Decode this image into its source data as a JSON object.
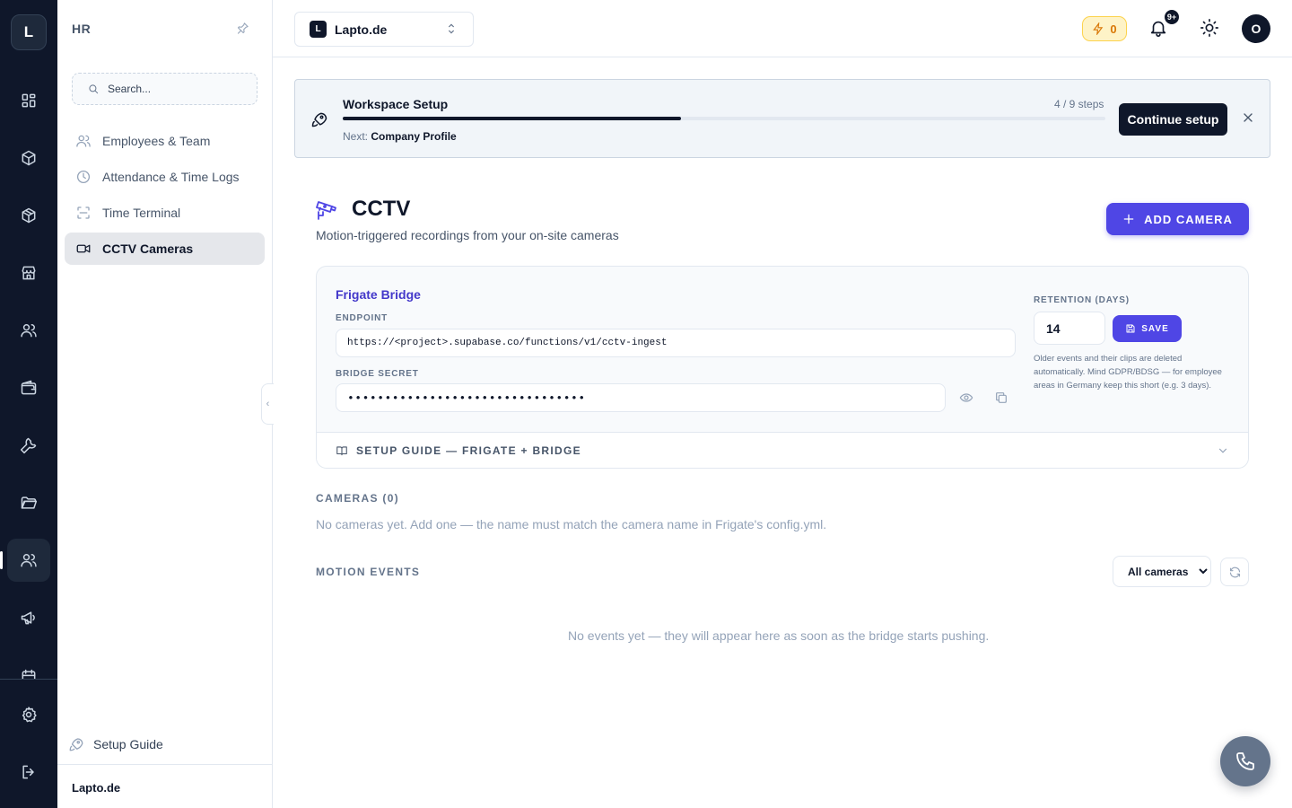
{
  "rail": {
    "logo": "L",
    "icons": [
      "dashboard-icon",
      "box-icon",
      "package-icon",
      "store-icon",
      "users-icon",
      "wallet-icon",
      "wrench-icon",
      "folder-icon",
      "hr-users-icon",
      "megaphone-icon",
      "settings-icon",
      "logout-icon"
    ]
  },
  "sidebar": {
    "title": "HR",
    "search_placeholder": "Search...",
    "items": [
      {
        "label": "Employees & Team",
        "icon": "users-icon"
      },
      {
        "label": "Attendance & Time Logs",
        "icon": "clock-icon"
      },
      {
        "label": "Time Terminal",
        "icon": "scan-icon"
      },
      {
        "label": "CCTV Cameras",
        "icon": "video-icon"
      }
    ],
    "setup_guide": "Setup Guide",
    "footer": "Lapto.de"
  },
  "topbar": {
    "workspace_badge": "L",
    "workspace_name": "Lapto.de",
    "credits": "0",
    "notifications": "9+",
    "avatar": "O"
  },
  "setup": {
    "title": "Workspace Setup",
    "steps": "4 / 9 steps",
    "progress": 0.444,
    "next_label": "Next:",
    "next_value": "Company Profile",
    "continue_label": "Continue setup"
  },
  "page": {
    "title": "CCTV",
    "subtitle": "Motion-triggered recordings from your on-site cameras",
    "add_button": "ADD CAMERA"
  },
  "bridge": {
    "title": "Frigate Bridge",
    "endpoint_label": "ENDPOINT",
    "endpoint_value": "https://<project>.supabase.co/functions/v1/cctv-ingest",
    "secret_label": "BRIDGE SECRET",
    "secret_value": "••••••••••••••••••••••••••••••••",
    "retention_label": "RETENTION (DAYS)",
    "retention_value": "14",
    "save_label": "SAVE",
    "retention_note": "Older events and their clips are deleted automatically. Mind GDPR/BDSG — for employee areas in Germany keep this short (e.g. 3 days).",
    "guide_label": "SETUP GUIDE — FRIGATE + BRIDGE"
  },
  "cameras": {
    "heading": "CAMERAS (0)",
    "empty": "No cameras yet. Add one — the name must match the camera name in Frigate's config.yml."
  },
  "events": {
    "heading": "MOTION EVENTS",
    "filter_selected": "All cameras",
    "empty": "No events yet — they will appear here as soon as the bridge starts pushing."
  },
  "colors": {
    "accent": "#4f46e5",
    "dark": "#0f172a",
    "muted": "#64748b"
  }
}
